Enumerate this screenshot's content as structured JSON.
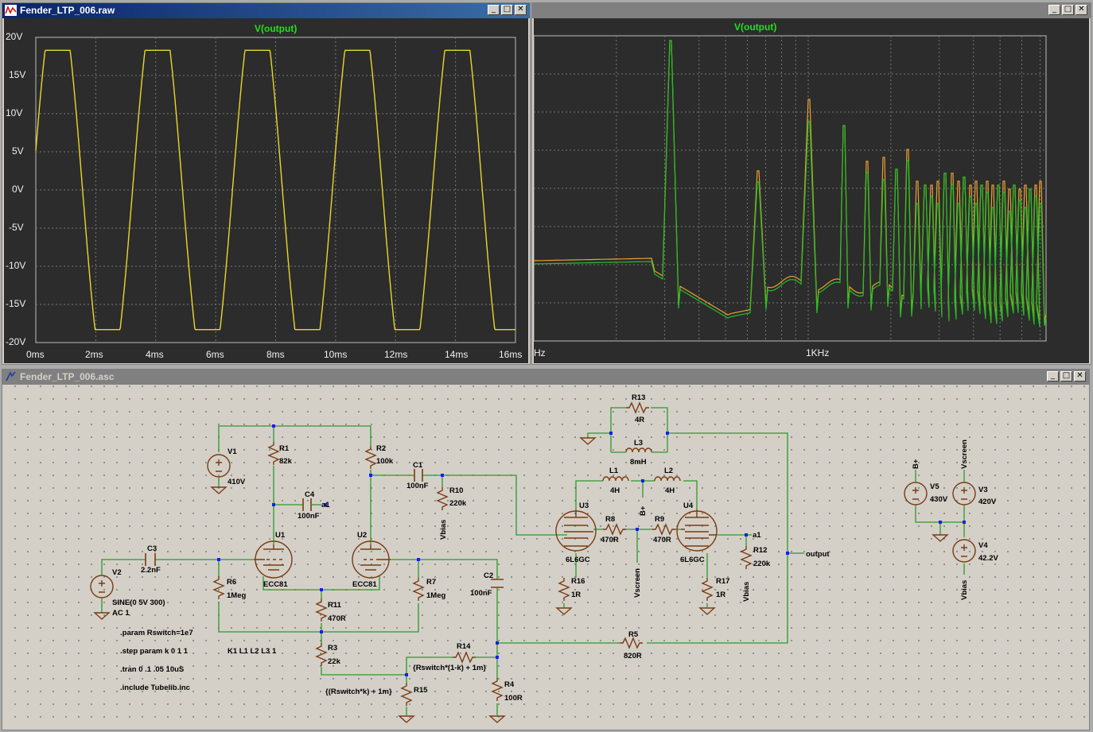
{
  "waveform_window": {
    "title": "Fender_LTP_006.raw",
    "trace_title": "V(output)",
    "y_ticks": [
      "20V",
      "15V",
      "10V",
      "5V",
      "0V",
      "-5V",
      "-10V",
      "-15V",
      "-20V"
    ],
    "x_ticks": [
      "0ms",
      "2ms",
      "4ms",
      "6ms",
      "8ms",
      "10ms",
      "12ms",
      "14ms",
      "16ms"
    ]
  },
  "fft_window": {
    "trace_title": "V(output)",
    "x_ticks": [
      "Hz",
      "1KHz"
    ]
  },
  "schematic_window": {
    "title": "Fender_LTP_006.asc",
    "components": {
      "r1": [
        "R1",
        "82k"
      ],
      "r2": [
        "R2",
        "100k"
      ],
      "r3": [
        "R3",
        "22k"
      ],
      "r4": [
        "R4",
        "100R"
      ],
      "r5": [
        "R5",
        "820R"
      ],
      "r6": [
        "R6",
        "1Meg"
      ],
      "r7": [
        "R7",
        "1Meg"
      ],
      "r8": [
        "R8",
        "470R"
      ],
      "r9": [
        "R9",
        "470R"
      ],
      "r10": [
        "R10",
        "220k"
      ],
      "r11": [
        "R11",
        "470R"
      ],
      "r12": [
        "R12",
        "220k"
      ],
      "r13": [
        "R13",
        "4R"
      ],
      "r14": [
        "R14",
        "{Rswitch*(1-k) + 1m}"
      ],
      "r15": [
        "R15",
        "{(Rswitch*k) + 1m}"
      ],
      "r16": [
        "R16",
        "1R"
      ],
      "r17": [
        "R17",
        "1R"
      ],
      "c1": [
        "C1",
        "100nF"
      ],
      "c2": [
        "C2",
        "100nF"
      ],
      "c3": [
        "C3",
        "2.2nF"
      ],
      "c4": [
        "C4",
        "100nF"
      ],
      "l1": [
        "L1",
        "4H"
      ],
      "l2": [
        "L2",
        "4H"
      ],
      "l3": [
        "L3",
        "8mH"
      ],
      "u1": [
        "U1",
        "ECC81"
      ],
      "u2": [
        "U2",
        "ECC81"
      ],
      "u3": [
        "U3",
        "6L6GC"
      ],
      "u4": [
        "U4",
        "6L6GC"
      ],
      "v1": [
        "V1",
        "410V"
      ],
      "v2": [
        "V2",
        "SINE(0 5V 300)"
      ],
      "v3": [
        "V3",
        "420V"
      ],
      "v4": [
        "V4",
        "42.2V"
      ],
      "v5": [
        "V5",
        "430V"
      ]
    },
    "v2_ac": "AC 1",
    "net_labels": {
      "a1": "a1",
      "vbias": "Vbias",
      "vscreen": "Vscreen",
      "bplus": "B+",
      "output": "output"
    },
    "directives": [
      ".param Rswitch=1e7",
      ".step param k 0 1 1",
      ".tran 0 .1 .05 10uS",
      ".include Tubelib.inc"
    ],
    "coupling": "K1 L1 L2 L3 1"
  },
  "chart_data": [
    {
      "type": "line",
      "title": "V(output)",
      "xlabel": "",
      "ylabel": "",
      "xlim": [
        0,
        16
      ],
      "ylim": [
        -20,
        20
      ],
      "x_unit": "ms",
      "y_unit": "V",
      "grid": true,
      "series": [
        {
          "name": "V(output)",
          "color": "#e8d82a",
          "x": [
            0,
            0.42,
            1.05,
            1.67,
            2.1,
            2.52,
            3.15,
            3.77,
            4.2
          ],
          "y": [
            5,
            18.3,
            18.3,
            0,
            -18.3,
            -18.3,
            0,
            18.3,
            18.3
          ]
        }
      ]
    },
    {
      "type": "line",
      "title": "V(output)",
      "xlabel": "",
      "ylabel": "",
      "x_scale": "log",
      "grid": true,
      "series": [
        {
          "name": "",
          "color": "#e8a030"
        },
        {
          "name": "",
          "color": "#22c022"
        }
      ]
    }
  ]
}
